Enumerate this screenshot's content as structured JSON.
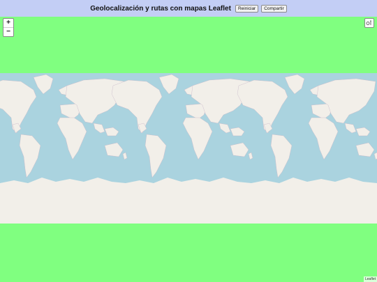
{
  "header": {
    "title": "Geolocalización y rutas con mapas Leaflet",
    "reset_label": "Reiniciar",
    "share_label": "Compartir"
  },
  "map": {
    "zoom_in_label": "+",
    "zoom_out_label": "−",
    "attribution": "Leaflet",
    "ocean_color": "#aad3df",
    "land_color": "#f2efe9",
    "background_color": "#80ff80",
    "locate_icon": "locate-icon"
  }
}
